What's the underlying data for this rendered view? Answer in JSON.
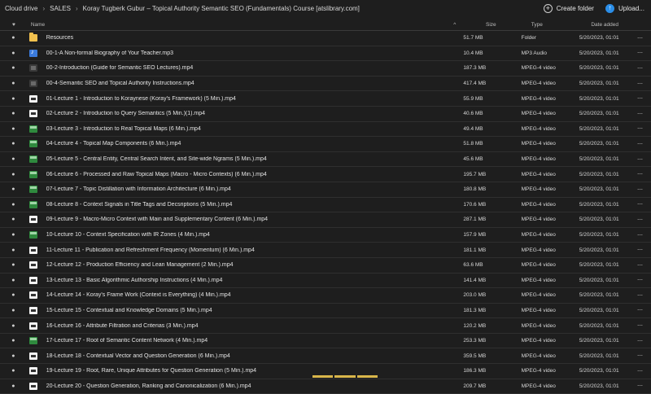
{
  "breadcrumb": [
    "Cloud drive",
    "SALES",
    "Koray Tugberk Gubur – Topical Authority Semantic SEO (Fundamentals) Course [atslibrary.com]"
  ],
  "actions": {
    "create_folder": "Create folder",
    "upload": "Upload..."
  },
  "columns": {
    "name": "Name",
    "size": "Size",
    "type": "Type",
    "date": "Date added"
  },
  "files": [
    {
      "name": "Resources",
      "size": "51.7 MB",
      "type": "Folder",
      "date": "5/20/2023, 01:01",
      "icon": "folder-icon"
    },
    {
      "name": "00-1-A Non-formal Biography of Your Teacher.mp3",
      "size": "10.4 MB",
      "type": "MP3 Audio",
      "date": "5/20/2023, 01:01",
      "icon": "audio-icon"
    },
    {
      "name": "00-2-Introduction (Guide for Semantic SEO Lectures).mp4",
      "size": "187.3 MB",
      "type": "MPEG-4 video",
      "date": "5/20/2023, 01:01",
      "icon": "video-dark"
    },
    {
      "name": "00-4-Semantic SEO and Topical Authority Instructions.mp4",
      "size": "417.4 MB",
      "type": "MPEG-4 video",
      "date": "5/20/2023, 01:01",
      "icon": "video-dark"
    },
    {
      "name": "01-Lecture 1 - Introduction to Koraynese (Koray's Framework) (5 Min.).mp4",
      "size": "55.9 MB",
      "type": "MPEG-4 video",
      "date": "5/20/2023, 01:01",
      "icon": "video-white"
    },
    {
      "name": "02-Lecture 2 - Introduction to Query Semantics (5 Min.)(1).mp4",
      "size": "40.6 MB",
      "type": "MPEG-4 video",
      "date": "5/20/2023, 01:01",
      "icon": "video-white"
    },
    {
      "name": "03-Lecture 3 - Introduction to Real Topical Maps (6 Min.).mp4",
      "size": "49.4 MB",
      "type": "MPEG-4 video",
      "date": "5/20/2023, 01:01",
      "icon": "video-green"
    },
    {
      "name": "04-Lecture 4 - Topical Map Components (6 Min.).mp4",
      "size": "51.8 MB",
      "type": "MPEG-4 video",
      "date": "5/20/2023, 01:01",
      "icon": "video-green"
    },
    {
      "name": "05-Lecture 5 - Central Entity, Central Search Intent, and Site-wide Ngrams (5 Min.).mp4",
      "size": "45.6 MB",
      "type": "MPEG-4 video",
      "date": "5/20/2023, 01:01",
      "icon": "video-green"
    },
    {
      "name": "06-Lecture 6 - Processed and Raw Topical Maps (Macro - Micro Contexts) (6 Min.).mp4",
      "size": "195.7 MB",
      "type": "MPEG-4 video",
      "date": "5/20/2023, 01:01",
      "icon": "video-green"
    },
    {
      "name": "07-Lecture 7 - Topic Distillation with Information Architecture (6 Min.).mp4",
      "size": "180.8 MB",
      "type": "MPEG-4 video",
      "date": "5/20/2023, 01:01",
      "icon": "video-green"
    },
    {
      "name": "08-Lecture 8 - Context Signals in Title Tags and Decsriptions (5 Min.).mp4",
      "size": "170.6 MB",
      "type": "MPEG-4 video",
      "date": "5/20/2023, 01:01",
      "icon": "video-green"
    },
    {
      "name": "09-Lecture 9 - Macro-Micro Context with Main and Supplementary Content (6 Min.).mp4",
      "size": "287.1 MB",
      "type": "MPEG-4 video",
      "date": "5/20/2023, 01:01",
      "icon": "video-white"
    },
    {
      "name": "10-Lecture 10 - Context Specification with IR Zones (4 Min.).mp4",
      "size": "157.9 MB",
      "type": "MPEG-4 video",
      "date": "5/20/2023, 01:01",
      "icon": "video-green"
    },
    {
      "name": "11-Lecture 11 - Publication and Refreshment Frequency (Momentum) (6 Min.).mp4",
      "size": "181.1 MB",
      "type": "MPEG-4 video",
      "date": "5/20/2023, 01:01",
      "icon": "video-white"
    },
    {
      "name": "12-Lecture 12 - Production Efficiency and Lean Management (2 Min.).mp4",
      "size": "63.6 MB",
      "type": "MPEG-4 video",
      "date": "5/20/2023, 01:01",
      "icon": "video-white"
    },
    {
      "name": "13-Lecture 13 - Basic Algorithmic Authorship Instructions (4 Min.).mp4",
      "size": "141.4 MB",
      "type": "MPEG-4 video",
      "date": "5/20/2023, 01:01",
      "icon": "video-white"
    },
    {
      "name": "14-Lecture 14 - Koray's Frame Work (Context is Everything) (4 Min.).mp4",
      "size": "203.0 MB",
      "type": "MPEG-4 video",
      "date": "5/20/2023, 01:01",
      "icon": "video-white"
    },
    {
      "name": "15-Lecture 15 - Contextual and Knowledge Domains (5 Min.).mp4",
      "size": "181.3 MB",
      "type": "MPEG-4 video",
      "date": "5/20/2023, 01:01",
      "icon": "video-white"
    },
    {
      "name": "16-Lecture 16 - Attribute Filtration and Criterias (3 Min.).mp4",
      "size": "120.2 MB",
      "type": "MPEG-4 video",
      "date": "5/20/2023, 01:01",
      "icon": "video-white"
    },
    {
      "name": "17-Lecture 17 - Root of Semantic Content Network (4 Min.).mp4",
      "size": "253.3 MB",
      "type": "MPEG-4 video",
      "date": "5/20/2023, 01:01",
      "icon": "video-green"
    },
    {
      "name": "18-Lecture 18 - Contextual Vector and Question Generation (6 Min.).mp4",
      "size": "359.5 MB",
      "type": "MPEG-4 video",
      "date": "5/20/2023, 01:01",
      "icon": "video-white"
    },
    {
      "name": "19-Lecture 19 - Root, Rare, Unique Attributes for Question Generation (5 Min.).mp4",
      "size": "186.3 MB",
      "type": "MPEG-4 video",
      "date": "5/20/2023, 01:01",
      "icon": "video-white"
    },
    {
      "name": "20-Lecture 20 - Question Generation, Ranking and Canonicalization (6 Min.).mp4",
      "size": "209.7 MB",
      "type": "MPEG-4 video",
      "date": "5/20/2023, 01:01",
      "icon": "video-white"
    }
  ]
}
